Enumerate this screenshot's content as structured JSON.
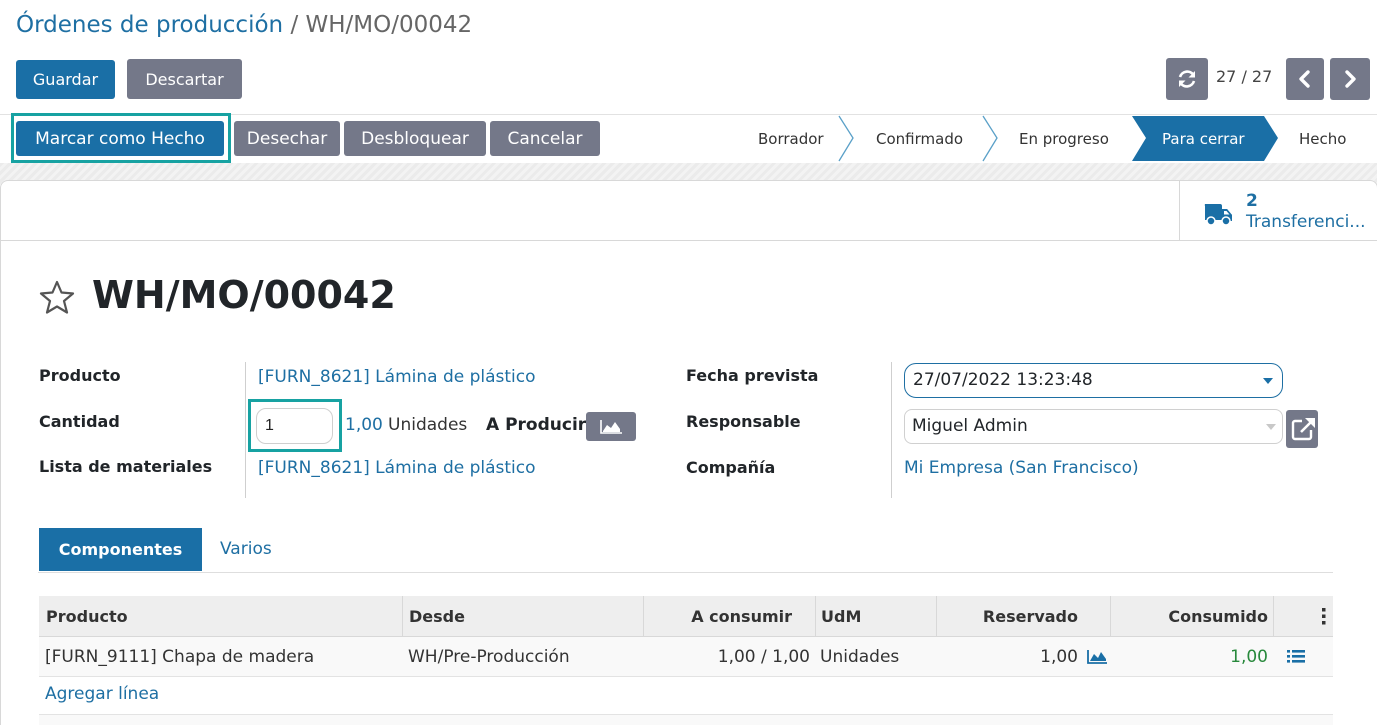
{
  "breadcrumb": {
    "parent": "Órdenes de producción",
    "separator": "/",
    "current": "WH/MO/00042"
  },
  "control_panel": {
    "save_label": "Guardar",
    "discard_label": "Descartar",
    "pager_value": "27 / 27"
  },
  "header_buttons": {
    "mark_done": "Marcar como Hecho",
    "scrap": "Desechar",
    "unlock": "Desbloquear",
    "cancel": "Cancelar"
  },
  "stages": [
    {
      "label": "Borrador",
      "active": false
    },
    {
      "label": "Confirmado",
      "active": false
    },
    {
      "label": "En progreso",
      "active": false
    },
    {
      "label": "Para cerrar",
      "active": true
    },
    {
      "label": "Hecho",
      "active": false
    }
  ],
  "smart_button": {
    "count": "2",
    "label": "Transferenci..."
  },
  "record": {
    "title": "WH/MO/00042",
    "product_label": "Producto",
    "product_value": "[FURN_8621] Lámina de plástico",
    "quantity_label": "Cantidad",
    "quantity_input": "1",
    "quantity_produced": "1,00",
    "uom": "Unidades",
    "to_produce_label": "A Producir",
    "bom_label": "Lista de materiales",
    "bom_value": "[FURN_8621] Lámina de plástico",
    "date_label": "Fecha prevista",
    "date_value": "27/07/2022 13:23:48",
    "responsible_label": "Responsable",
    "responsible_value": "Miguel Admin",
    "company_label": "Compañía",
    "company_value": "Mi Empresa (San Francisco)"
  },
  "tabs": [
    {
      "label": "Componentes",
      "active": true
    },
    {
      "label": "Varios",
      "active": false
    }
  ],
  "table": {
    "headers": [
      "Producto",
      "Desde",
      "A consumir",
      "UdM",
      "Reservado",
      "Consumido"
    ],
    "rows": [
      {
        "product": "[FURN_9111] Chapa de madera",
        "from": "WH/Pre-Producción",
        "to_consume": "1,00 / 1,00",
        "uom": "Unidades",
        "reserved": "1,00",
        "consumed": "1,00"
      }
    ],
    "add_line": "Agregar línea"
  },
  "colors": {
    "primary": "#1a6fa6",
    "secondary": "#747889",
    "highlight": "#17a2a2",
    "consumed_green": "#28893c"
  }
}
